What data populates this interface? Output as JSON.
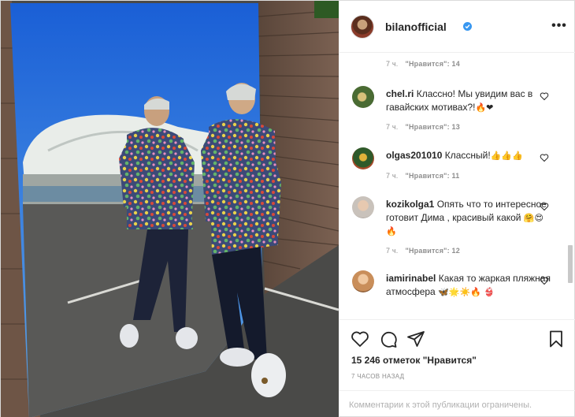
{
  "post": {
    "username": "bilanofficial",
    "more_label": "•••",
    "icons": {
      "verified": "verified-badge-icon",
      "more": "more-options-icon",
      "like": "heart-outline-icon",
      "comment": "comment-bubble-icon",
      "share": "paper-plane-icon",
      "save": "bookmark-icon"
    },
    "likes_label": "15 246 отметок \"Нравится\"",
    "time_ago": "7 ЧАСОВ НАЗАД",
    "comments_closed": "Комментарии к этой публикации ограничены."
  },
  "comments": [
    {
      "username": "",
      "text": "",
      "time": "7 ч.",
      "likes": "\"Нравится\": 14"
    },
    {
      "username": "chel.ri",
      "text": "Классно! Мы увидим вас в гавайских мотивах?!",
      "emoji": "🔥❤",
      "time": "7 ч.",
      "likes": "\"Нравится\": 13"
    },
    {
      "username": "olgas201010",
      "text": "Классный!",
      "emoji": "👍👍👍",
      "time": "7 ч.",
      "likes": "\"Нравится\": 11"
    },
    {
      "username": "kozikolga1",
      "text": "Опять что то интересное готовит Дима , красивый какой",
      "emoji": "🤗😍🔥",
      "time": "7 ч.",
      "likes": "\"Нравится\": 12"
    },
    {
      "username": "iamirinabel",
      "text": "Какая то жаркая пляжная атмосфера",
      "emoji": "🦋🌟☀️🔥 👙",
      "time": "",
      "likes": ""
    }
  ],
  "colors": {
    "accent": "#3897f0",
    "text": "#262626",
    "muted": "#8e8e8e",
    "heart_red": "#ed4956"
  }
}
